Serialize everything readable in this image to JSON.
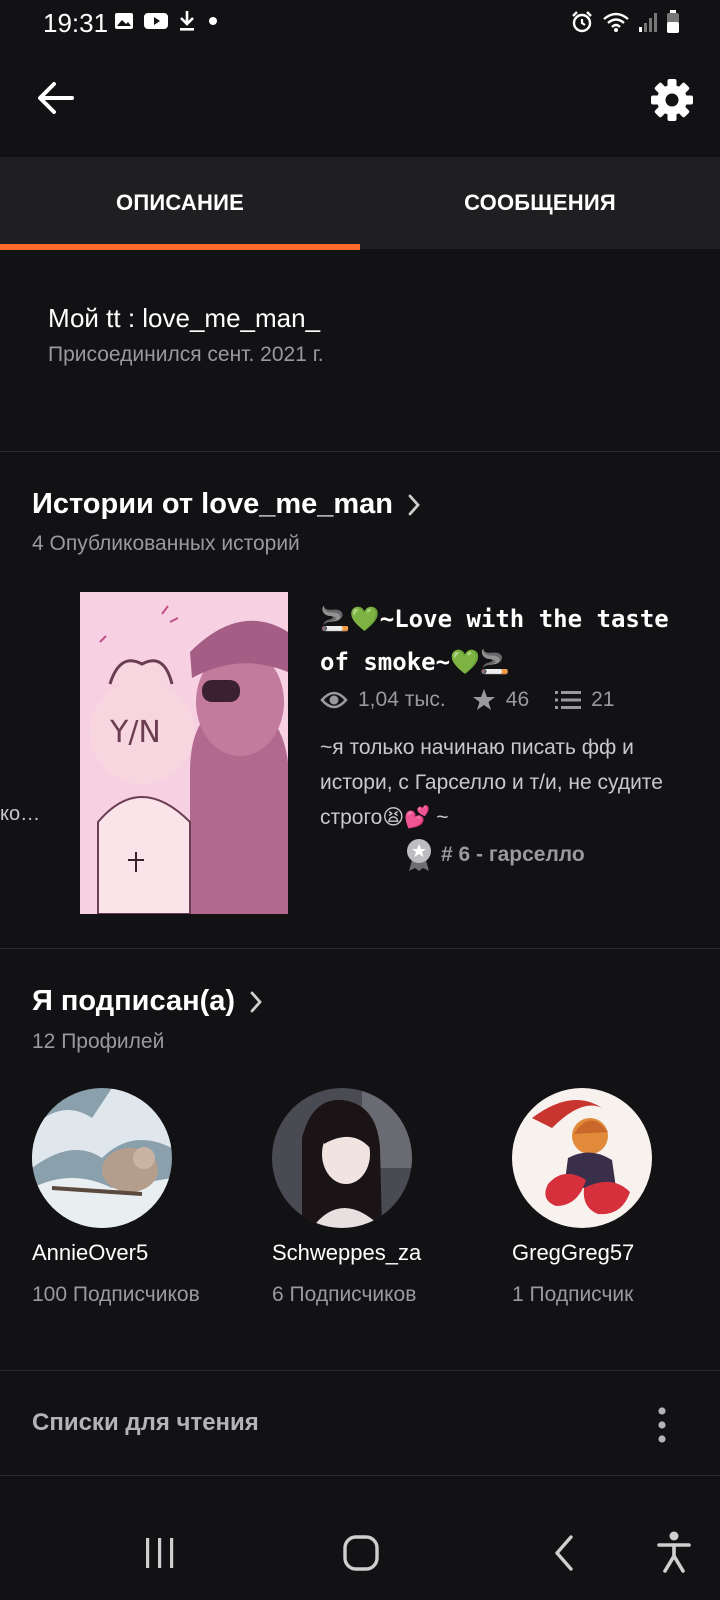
{
  "status_bar": {
    "time": "19:31"
  },
  "tabs": [
    {
      "label": "ОПИСАНИЕ",
      "active": true
    },
    {
      "label": "СООБЩЕНИЯ",
      "active": false
    }
  ],
  "about": {
    "title": "Мой tt : love_me_man_",
    "joined": "Присоединился сент. 2021 г."
  },
  "stories": {
    "title": "Истории от love_me_man",
    "count": "4 Опубликованных историй",
    "peek_text": "ко…",
    "featured": {
      "title": "🚬💚~Love with the taste of smoke~💚🚬",
      "views": "1,04 тыс.",
      "votes": "46",
      "parts": "21",
      "description": "~я только начинаю писать фф и истори, с Гарселло и т/и, не судите строго😫💕 ~",
      "rank": "# 6 - гарселло"
    }
  },
  "following": {
    "title": "Я подписан(а)",
    "count": "12 Профилей",
    "profiles": [
      {
        "name": "AnnieOver5",
        "followers": "100 Подписчиков"
      },
      {
        "name": "Schweppes_za",
        "followers": "6 Подписчиков"
      },
      {
        "name": "GregGreg57",
        "followers": "1 Подписчик"
      }
    ]
  },
  "reading_lists": {
    "title": "Списки для чтения"
  },
  "colors": {
    "accent": "#ff6a2b",
    "background": "#121114",
    "tab_bar": "#1f1e21"
  }
}
